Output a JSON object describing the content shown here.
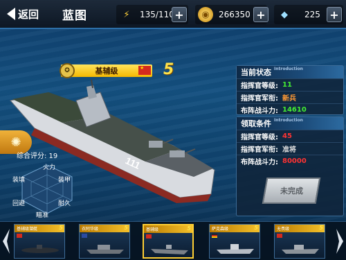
{
  "header": {
    "back_label": "返回",
    "title": "蓝图",
    "energy": "135/110",
    "coins": "266350",
    "gems": "225"
  },
  "ship": {
    "name": "基辅级",
    "level": "5",
    "hull_number": "111"
  },
  "score": {
    "label": "综合评分",
    "value": "19",
    "display": "综合评分: 19"
  },
  "radar": {
    "axes": [
      "火力",
      "装甲",
      "耐久",
      "瞄准",
      "回避",
      "装填"
    ]
  },
  "current_status": {
    "title": "当前状态",
    "subtitle": "Introduction",
    "rows": [
      {
        "key": "指挥官等级:",
        "value": "11",
        "color": "#44ee33"
      },
      {
        "key": "指挥官军衔:",
        "value": "新兵",
        "color": "#ff9933"
      },
      {
        "key": "布阵战斗力:",
        "value": "14610",
        "color": "#44ee33"
      }
    ]
  },
  "requirements": {
    "title": "领取条件",
    "subtitle": "Introduction",
    "rows": [
      {
        "key": "指挥官等级:",
        "value": "45",
        "color": "#ff3333"
      },
      {
        "key": "指挥官军衔:",
        "value": "准将",
        "color": "#dddddd"
      },
      {
        "key": "布阵战斗力:",
        "value": "80000",
        "color": "#ff3333"
      }
    ]
  },
  "status_button": "未完成",
  "carousel": [
    {
      "name": "基辅级潜艇",
      "level": "5",
      "flag": "#d42a1e",
      "selected": false
    },
    {
      "name": "衣阿华级",
      "level": "5",
      "flag": "#2a4aa0",
      "selected": false
    },
    {
      "name": "基辅级",
      "level": "5",
      "flag": "#d42a1e",
      "selected": true
    },
    {
      "name": "萨克森级",
      "level": "5",
      "flag": "#222222",
      "selected": false
    },
    {
      "name": "无畏级",
      "level": "5",
      "flag": "#d42a1e",
      "selected": false
    }
  ],
  "colors": {
    "accent": "#ffcf33",
    "panel_border": "#3a6a96"
  }
}
